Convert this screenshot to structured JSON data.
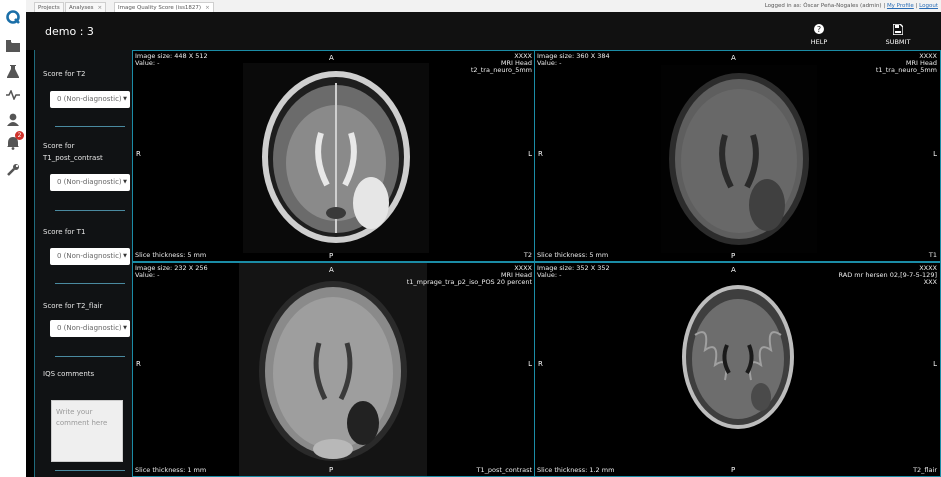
{
  "browser_tabs": [
    {
      "label": "Projects",
      "active": false
    },
    {
      "label": "Analyses",
      "active": false,
      "closable": true
    },
    {
      "label": "Image Quality Score (iss1827)",
      "active": true,
      "closable": true
    }
  ],
  "user_info": {
    "prefix": "Logged in as: Óscar Peña-Nogales (admin) |",
    "my_profile": "My Profile",
    "divider": "|",
    "logout": "Logout"
  },
  "rail_icons": [
    "q-logo-icon",
    "folder-icon",
    "flask-icon",
    "activity-icon",
    "user-icon",
    "bell-icon",
    "wrench-icon"
  ],
  "notifications": {
    "count": "2"
  },
  "header": {
    "title": "demo : 3",
    "help_label": "HELP",
    "submit_label": "SUBMIT"
  },
  "sidebar": {
    "scores": [
      {
        "label": "Score for T2",
        "value": "0 (Non-diagnostic)"
      },
      {
        "label": "Score for T1_post_contrast",
        "value": "0 (Non-diagnostic)"
      },
      {
        "label": "Score for T1",
        "value": "0 (Non-diagnostic)"
      },
      {
        "label": "Score for T2_flair",
        "value": "0 (Non-diagnostic)"
      }
    ],
    "comments_label": "IQS comments",
    "comments_placeholder": "Write your comment here"
  },
  "viewports": [
    {
      "image_size": "Image size: 448 X 512",
      "value": "Value: -",
      "top_right": [
        "XXXX",
        "MRI Head",
        "t2_tra_neuro_5mm"
      ],
      "orient": {
        "top": "A",
        "bottom": "P",
        "left": "R",
        "right": "L"
      },
      "slice_thickness": "Slice thickness: 5 mm",
      "series_label": "T2"
    },
    {
      "image_size": "Image size: 360 X 384",
      "value": "Value: -",
      "top_right": [
        "XXXX",
        "MRI Head",
        "t1_tra_neuro_5mm"
      ],
      "orient": {
        "top": "A",
        "bottom": "P",
        "left": "R",
        "right": "L"
      },
      "slice_thickness": "Slice thickness: 5 mm",
      "series_label": "T1"
    },
    {
      "image_size": "Image size: 232 X 256",
      "value": "Value: -",
      "top_right": [
        "XXXX",
        "MRI Head",
        "t1_mprage_tra_p2_iso_POS 20 percent"
      ],
      "orient": {
        "top": "A",
        "bottom": "P",
        "left": "R",
        "right": "L"
      },
      "slice_thickness": "Slice thickness: 1 mm",
      "series_label": "T1_post_contrast"
    },
    {
      "image_size": "Image size: 352 X 352",
      "value": "Value: -",
      "top_right": [
        "XXXX",
        "RAD mr hersen 02,[9-7-5-129]",
        "XXX"
      ],
      "orient": {
        "top": "A",
        "bottom": "P",
        "left": "R",
        "right": "L"
      },
      "slice_thickness": "Slice thickness: 1.2 mm",
      "series_label": "T2_flair"
    }
  ],
  "colors": {
    "accent": "#1b8ca6",
    "background": "#000000",
    "topbar": "#111111",
    "badge": "#d0332c"
  }
}
